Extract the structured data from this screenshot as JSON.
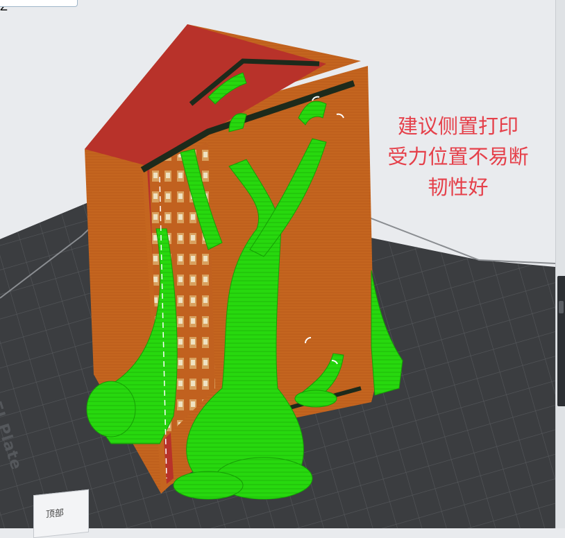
{
  "annotation": {
    "lines": [
      "建议侧置打印",
      "受力位置不易断",
      "韧性好"
    ],
    "color": "#e5404a"
  },
  "build_plate": {
    "label": "Textured PEI Plate",
    "color": "#3b3d40"
  },
  "view_cube": {
    "face_label": "顶部",
    "axis_label": "Z"
  },
  "colors": {
    "wall": "#c1611f",
    "wall_top": "#b8322a",
    "support": "#27d80e",
    "support_edge": "#169d05"
  }
}
